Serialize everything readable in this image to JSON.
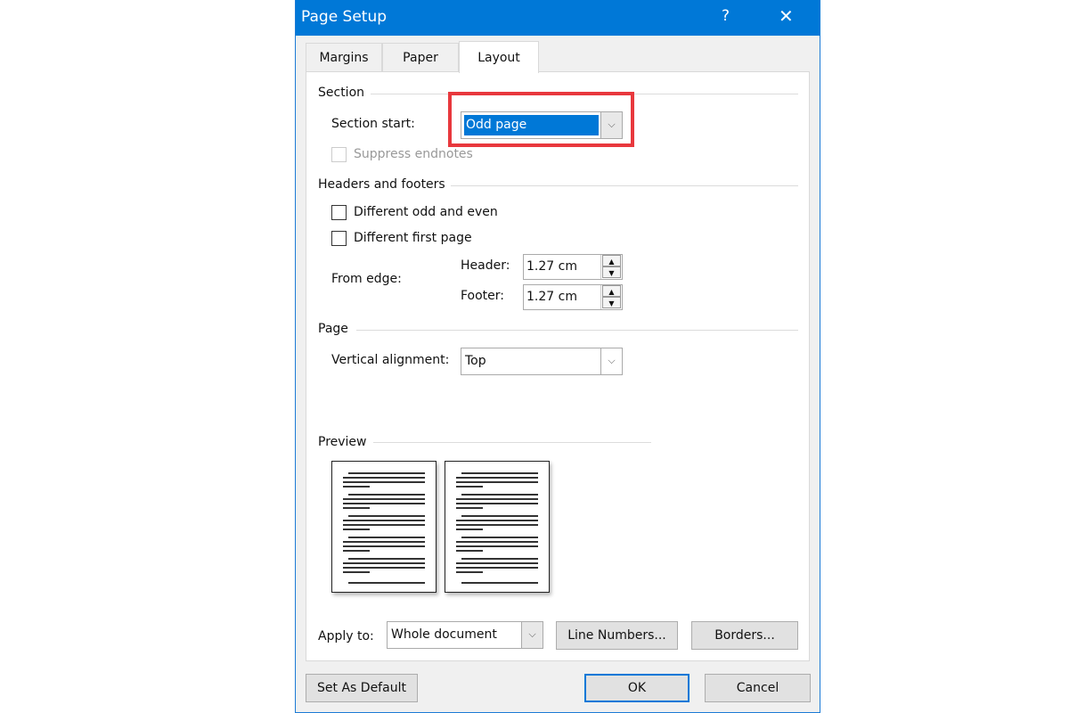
{
  "window": {
    "title": "Page Setup",
    "help": "?",
    "close": "✕"
  },
  "tabs": [
    {
      "label": "Margins"
    },
    {
      "label": "Paper"
    },
    {
      "label": "Layout",
      "active": true
    }
  ],
  "section": {
    "heading": "Section",
    "start_label": "Section start:",
    "start_value": "Odd page",
    "suppress_endnotes": "Suppress endnotes"
  },
  "headers_footers": {
    "heading": "Headers and footers",
    "odd_even": "Different odd and even",
    "first_page": "Different first page",
    "from_edge": "From edge:",
    "header_label": "Header:",
    "header_value": "1.27 cm",
    "footer_label": "Footer:",
    "footer_value": "1.27 cm"
  },
  "page": {
    "heading": "Page",
    "valign_label": "Vertical alignment:",
    "valign_value": "Top"
  },
  "preview": {
    "heading": "Preview"
  },
  "apply": {
    "label": "Apply to:",
    "value": "Whole document"
  },
  "buttons": {
    "line_numbers": "Line Numbers...",
    "borders": "Borders...",
    "set_default": "Set As Default",
    "ok": "OK",
    "cancel": "Cancel"
  },
  "colors": {
    "titlebar": "#0078d7",
    "highlight": "#e8383d",
    "selection": "#0078d7"
  }
}
